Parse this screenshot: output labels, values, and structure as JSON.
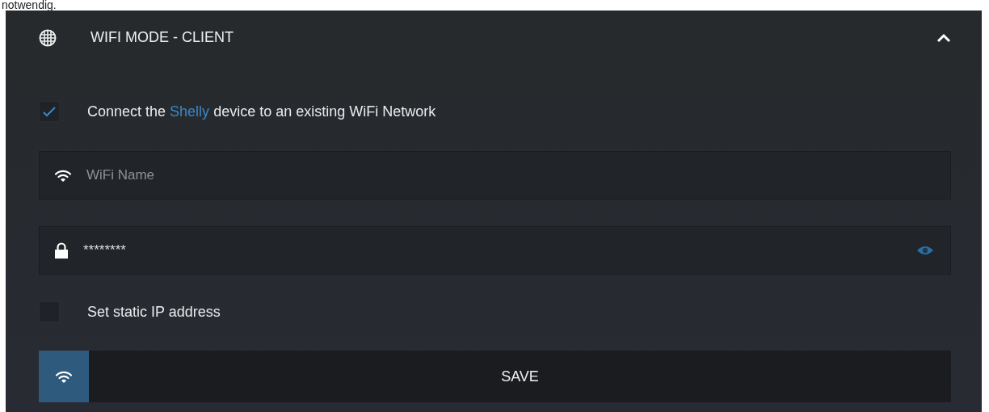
{
  "page_text": "notwendig.",
  "section": {
    "title": "WIFI MODE - CLIENT",
    "expanded": true
  },
  "options": [
    {
      "kind": "connect",
      "checked": true,
      "text_before": "Connect the",
      "link": "Shelly",
      "text_after": "device to an existing WiFi Network"
    }
  ],
  "fields": [
    {
      "kind": "wifi",
      "placeholder": "WiFi Name"
    },
    {
      "kind": "password",
      "value": "********"
    }
  ],
  "static_ip": {
    "checked": false,
    "label": "Set static IP address"
  },
  "save_button": {
    "label": "SAVE"
  }
}
